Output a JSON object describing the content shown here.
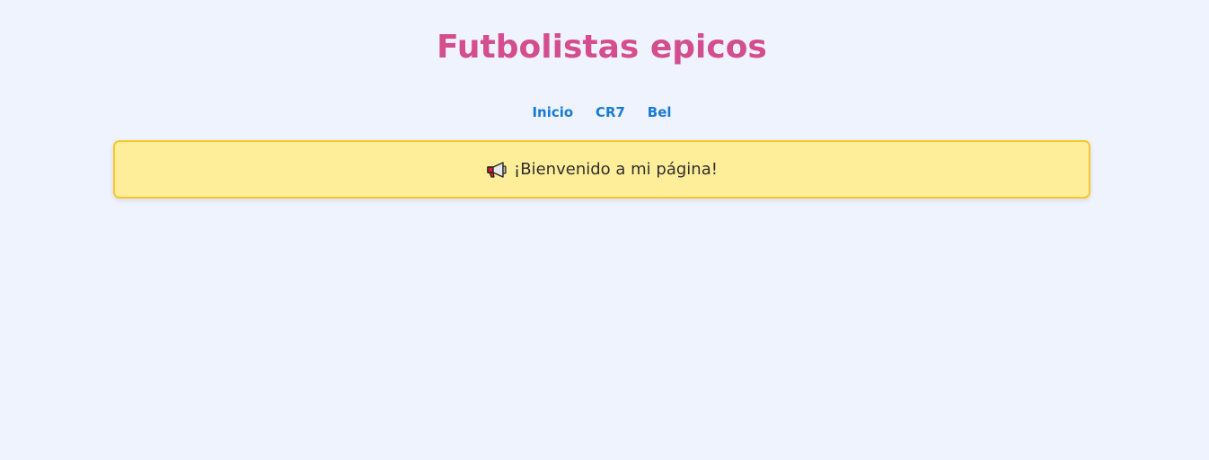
{
  "header": {
    "title": "Futbolistas epicos",
    "title_color": "#d44d8f"
  },
  "nav": {
    "link_color": "#1a7ad4",
    "items": [
      {
        "label": "Inicio"
      },
      {
        "label": "CR7"
      },
      {
        "label": "Bel"
      }
    ]
  },
  "banner": {
    "icon": "megaphone-icon",
    "text": "¡Bienvenido a mi página!",
    "background": "#ffee99",
    "border_color": "#f8c62e"
  },
  "page": {
    "background": "#eef3fd"
  }
}
